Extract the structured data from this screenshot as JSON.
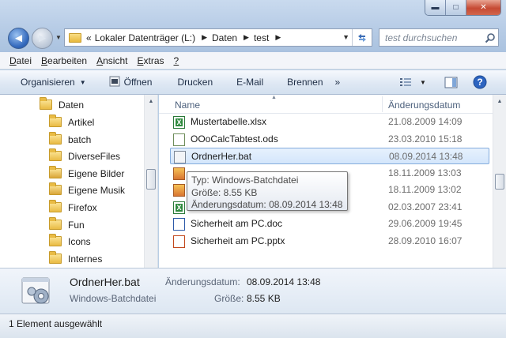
{
  "titlebar": {
    "minimize_glyph": "▬",
    "maximize_glyph": "□",
    "close_glyph": "✕"
  },
  "navigation": {
    "back_glyph": "◄",
    "forward_glyph": "►"
  },
  "address": {
    "prefix": "«",
    "segments": [
      "Lokaler Datenträger (L:)",
      "Daten",
      "test"
    ]
  },
  "search": {
    "placeholder": "test durchsuchen"
  },
  "menubar": [
    {
      "accel": "D",
      "rest": "atei"
    },
    {
      "accel": "B",
      "rest": "earbeiten"
    },
    {
      "accel": "A",
      "rest": "nsicht"
    },
    {
      "accel": "E",
      "pre": "",
      "rest": "xtras",
      "accel_pos": 1
    },
    {
      "accel": "?",
      "rest": ""
    }
  ],
  "commandbar": {
    "organize": "Organisieren",
    "open": "Öffnen",
    "print": "Drucken",
    "email": "E-Mail",
    "burn": "Brennen",
    "more": "»"
  },
  "tree": [
    {
      "label": "Daten",
      "indent": 0
    },
    {
      "label": "Artikel"
    },
    {
      "label": "batch"
    },
    {
      "label": "DiverseFiles"
    },
    {
      "label": "Eigene Bilder"
    },
    {
      "label": "Eigene Musik"
    },
    {
      "label": "Firefox"
    },
    {
      "label": "Fun"
    },
    {
      "label": "Icons"
    },
    {
      "label": "Internes"
    }
  ],
  "columns": {
    "name": "Name",
    "modified": "Änderungsdatum"
  },
  "files": [
    {
      "name": "Mustertabelle.xlsx",
      "date": "21.08.2009 14:09",
      "kind": "xls"
    },
    {
      "name": "OOoCalcTabtest.ods",
      "date": "23.03.2010 15:18",
      "kind": "ods"
    },
    {
      "name": "OrdnerHer.bat",
      "date": "08.09.2014 13:48",
      "kind": "bat",
      "selected": true
    },
    {
      "name": "",
      "date": "18.11.2009 13:03",
      "kind": "img"
    },
    {
      "name": "",
      "date": "18.11.2009 13:02",
      "kind": "img"
    },
    {
      "name": "",
      "date": "02.03.2007 23:41",
      "kind": "xls"
    },
    {
      "name": "Sicherheit am PC.doc",
      "date": "29.06.2009 19:45",
      "kind": "doc"
    },
    {
      "name": "Sicherheit am PC.pptx",
      "date": "28.09.2010 16:07",
      "kind": "ppt"
    }
  ],
  "tooltip": {
    "type": "Typ: Windows-Batchdatei",
    "size": "Größe: 8.55 KB",
    "modified": "Änderungsdatum: 08.09.2014 13:48"
  },
  "details": {
    "name": "OrdnerHer.bat",
    "type": "Windows-Batchdatei",
    "modified_label": "Änderungsdatum:",
    "modified_value": "08.09.2014 13:48",
    "size_label": "Größe:",
    "size_value": "8.55 KB"
  },
  "status": {
    "text": "1 Element ausgewählt"
  }
}
